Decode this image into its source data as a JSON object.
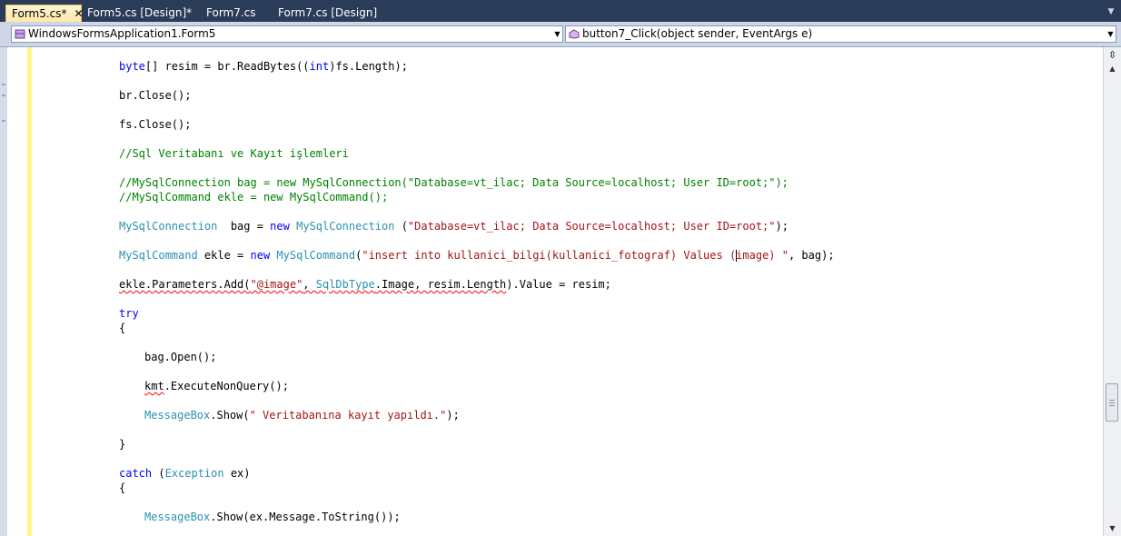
{
  "tabs": [
    {
      "label": "Form5.cs*",
      "active": true,
      "close_glyph": "✕"
    },
    {
      "label": "Form5.cs [Design]*",
      "active": false
    },
    {
      "label": "Form7.cs",
      "active": false
    },
    {
      "label": "Form7.cs [Design]",
      "active": false
    }
  ],
  "nav": {
    "class_combo": {
      "text": "WindowsFormsApplication1.Form5",
      "icon": "class-icon"
    },
    "member_combo": {
      "text": "button7_Click(object sender, EventArgs e)",
      "icon": "method-icon"
    }
  },
  "code": {
    "l01": {
      "t1": "byte",
      "t2": "[] resim = br.ReadBytes((",
      "t3": "int",
      "t4": ")fs.Length);"
    },
    "l02": {
      "t1": "br.Close();"
    },
    "l03": {
      "t1": "fs.Close();"
    },
    "l04": {
      "t1": "//Sql Veritabanı ve Kayıt işlemleri"
    },
    "l05": {
      "t1": "//MySqlConnection bag = new MySqlConnection(\"Database=vt_ilac; Data Source=localhost; User ID=root;\");"
    },
    "l06": {
      "t1": "//MySqlCommand ekle = new MySqlCommand();"
    },
    "l07": {
      "t1": "MySqlConnection",
      "t2": "  bag = ",
      "t3": "new",
      "t4": " ",
      "t5": "MySqlConnection",
      "t6": " (",
      "t7": "\"Database=vt_ilac; Data Source=localhost; User ID=root;\"",
      "t8": ");"
    },
    "l08": {
      "t1": "MySqlCommand",
      "t2": " ekle = ",
      "t3": "new",
      "t4": " ",
      "t5": "MySqlCommand",
      "t6": "(",
      "t7a": "\"insert into kullanici_bilgi(kullanici_fotograf) Values (",
      "t7b": "image) \"",
      "t8": ", bag);"
    },
    "l09": {
      "t1": "ekle.Parameters.Add(",
      "t2": "\"@image\"",
      "t3": ", ",
      "t4": "SqlDbType",
      "t5": ".Image, resim.Length",
      "t6": ").Value = resim;"
    },
    "l10": {
      "t1": "try"
    },
    "l11": {
      "t1": "{"
    },
    "l12": {
      "t1": "bag.Open();"
    },
    "l13": {
      "t1": "kmt",
      "t2": ".ExecuteNonQuery();"
    },
    "l14": {
      "t1": "MessageBox",
      "t2": ".Show(",
      "t3": "\" Veritabanına kayıt yapıldı.\"",
      "t4": ");"
    },
    "l15": {
      "t1": "}"
    },
    "l16": {
      "t1": "catch",
      "t2": " (",
      "t3": "Exception",
      "t4": " ex)"
    },
    "l17": {
      "t1": "{"
    },
    "l18": {
      "t1": "MessageBox",
      "t2": ".Show(ex.Message.ToString());"
    }
  },
  "colors": {
    "keyword": "#0000ff",
    "type": "#2b91af",
    "string": "#a31515",
    "comment": "#008000",
    "tab_strip": "#2b3c59",
    "active_tab": "#ffe8a6",
    "change_bar": "#fff58f"
  }
}
